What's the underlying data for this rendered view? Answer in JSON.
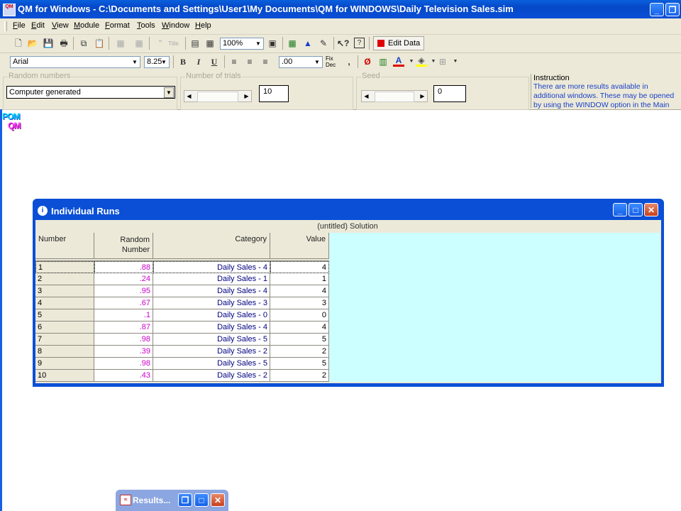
{
  "app": {
    "title": "QM for Windows - C:\\Documents and Settings\\User1\\My Documents\\QM for WINDOWS\\Daily Television Sales.sim",
    "icon_text": "QM"
  },
  "menu": [
    {
      "label": "File"
    },
    {
      "label": "Edit"
    },
    {
      "label": "View"
    },
    {
      "label": "Module"
    },
    {
      "label": "Format"
    },
    {
      "label": "Tools"
    },
    {
      "label": "Window"
    },
    {
      "label": "Help"
    }
  ],
  "toolbar1": {
    "zoom": "100%",
    "edit_data_label": "Edit Data",
    "title_icon_text": "Title"
  },
  "toolbar2": {
    "font": "Arial",
    "font_size": "8.25",
    "decimal_format": ".00",
    "fix_dec": "Fix\nDec"
  },
  "panel": {
    "random_numbers_label": "Random numbers",
    "random_numbers_value": "Computer generated",
    "trials_label": "Number of trials",
    "trials_value": "10",
    "seed_label": "Seed",
    "seed_value": "0",
    "instruction_label": "Instruction",
    "instruction_text": "There are more results available in additional windows. These may be opened by using the WINDOW option in the Main Menu."
  },
  "logo": {
    "line1": "POM",
    "line2": "QM"
  },
  "individual_runs": {
    "title": "Individual Runs",
    "solution_header": "(untitled) Solution",
    "columns": [
      "Number",
      "Random Number",
      "Category",
      "Value"
    ],
    "rows": [
      {
        "number": "1",
        "random": ".88",
        "category": "Daily Sales - 4",
        "value": "4"
      },
      {
        "number": "2",
        "random": ".24",
        "category": "Daily Sales - 1",
        "value": "1"
      },
      {
        "number": "3",
        "random": ".95",
        "category": "Daily Sales - 4",
        "value": "4"
      },
      {
        "number": "4",
        "random": ".67",
        "category": "Daily Sales - 3",
        "value": "3"
      },
      {
        "number": "5",
        "random": ".1",
        "category": "Daily Sales - 0",
        "value": "0"
      },
      {
        "number": "6",
        "random": ".87",
        "category": "Daily Sales - 4",
        "value": "4"
      },
      {
        "number": "7",
        "random": ".98",
        "category": "Daily Sales - 5",
        "value": "5"
      },
      {
        "number": "8",
        "random": ".39",
        "category": "Daily Sales - 2",
        "value": "2"
      },
      {
        "number": "9",
        "random": ".98",
        "category": "Daily Sales - 5",
        "value": "5"
      },
      {
        "number": "10",
        "random": ".43",
        "category": "Daily Sales - 2",
        "value": "2"
      }
    ]
  },
  "minimized_window": {
    "title": "Results..."
  },
  "colors": {
    "titlebar": "#0a4fd6",
    "grid_background": "#ccffff",
    "random_number_text": "#cc00cc",
    "category_text": "#000080"
  }
}
